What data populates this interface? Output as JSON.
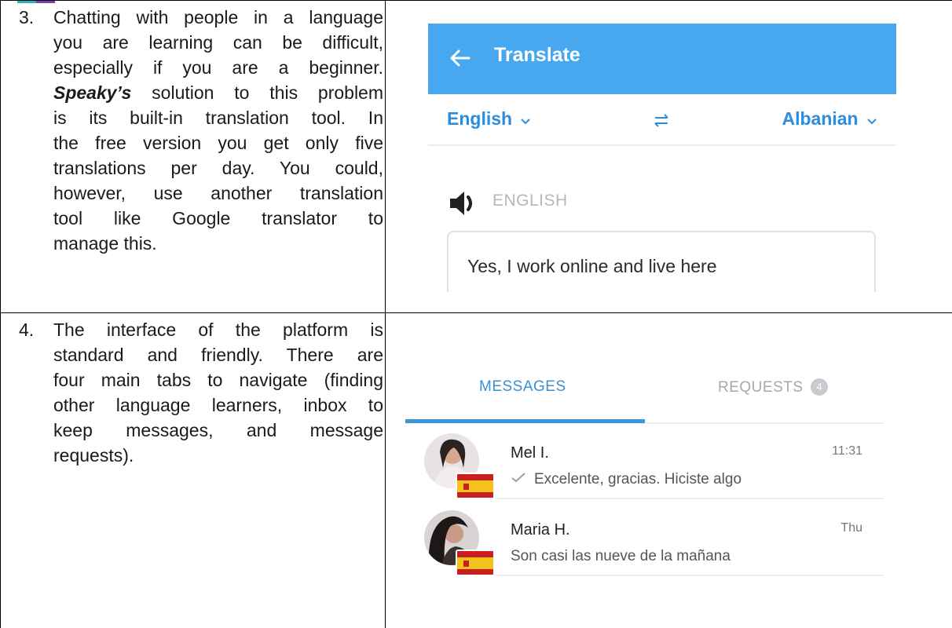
{
  "rows": [
    {
      "number": "3.",
      "lines": [
        "Chatting with people in a language",
        "you are learning can be difficult,",
        "especially if you are a beginner.",
        "solution to this problem",
        "is its built-in translation tool. In",
        "the free version you get only five",
        "translations per day. You could,",
        "however, use another translation",
        "tool like Google translator to"
      ],
      "bold_word": "Speaky’s",
      "last_line": "manage this."
    },
    {
      "number": "4.",
      "lines": [
        "The interface of the platform is",
        "standard and friendly. There are",
        "four main tabs to navigate (finding",
        "other language learners, inbox to",
        "keep messages, and message"
      ],
      "last_line": "requests)."
    }
  ],
  "translate": {
    "title": "Translate",
    "source_lang": "English",
    "target_lang": "Albanian",
    "source_label": "ENGLISH",
    "input_text": "Yes, I work online and live here",
    "colors": {
      "header": "#47a8f0",
      "accent": "#2a8ddd"
    }
  },
  "messages": {
    "tabs": {
      "messages": "MESSAGES",
      "requests": "REQUESTS",
      "requests_count": "4"
    },
    "conversations": [
      {
        "name": "Mel I.",
        "time": "11:31",
        "preview": "Excelente, gracias. Hiciste algo",
        "read": true,
        "flag": "spain-flag-icon"
      },
      {
        "name": "Maria H.",
        "time": "Thu",
        "preview": "Son casi las nueve de la mañana",
        "read": false,
        "flag": "spain-flag-icon"
      }
    ]
  }
}
